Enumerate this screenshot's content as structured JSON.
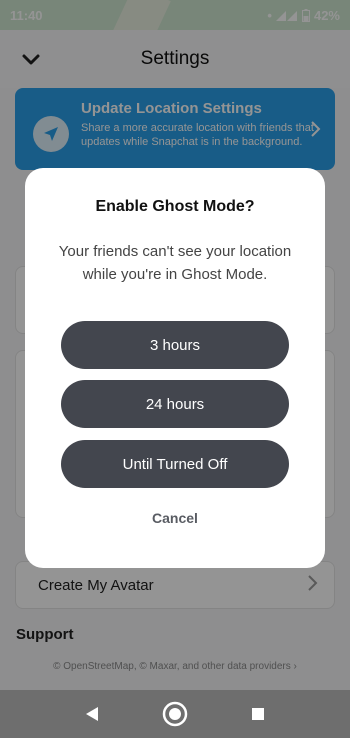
{
  "status_bar": {
    "time": "11:40",
    "battery": "42%"
  },
  "header": {
    "title": "Settings"
  },
  "location_card": {
    "title": "Update Location Settings",
    "description": "Share a more accurate location with friends that updates while Snapchat is in the background."
  },
  "background": {
    "avatar_row_label": "Create My Avatar",
    "support_heading": "Support",
    "credits": "© OpenStreetMap, © Maxar, and other data providers"
  },
  "dialog": {
    "title": "Enable Ghost Mode?",
    "body": "Your friends can't see your location while you're in Ghost Mode.",
    "options": [
      "3 hours",
      "24 hours",
      "Until Turned Off"
    ],
    "cancel": "Cancel"
  },
  "icons": {
    "back": "chevron-down-icon",
    "location": "location-arrow-icon",
    "nav": [
      "back-triangle-icon",
      "home-circle-icon",
      "recents-square-icon"
    ]
  },
  "colors": {
    "accent": "#2a9fe8",
    "pill": "#43464e"
  }
}
